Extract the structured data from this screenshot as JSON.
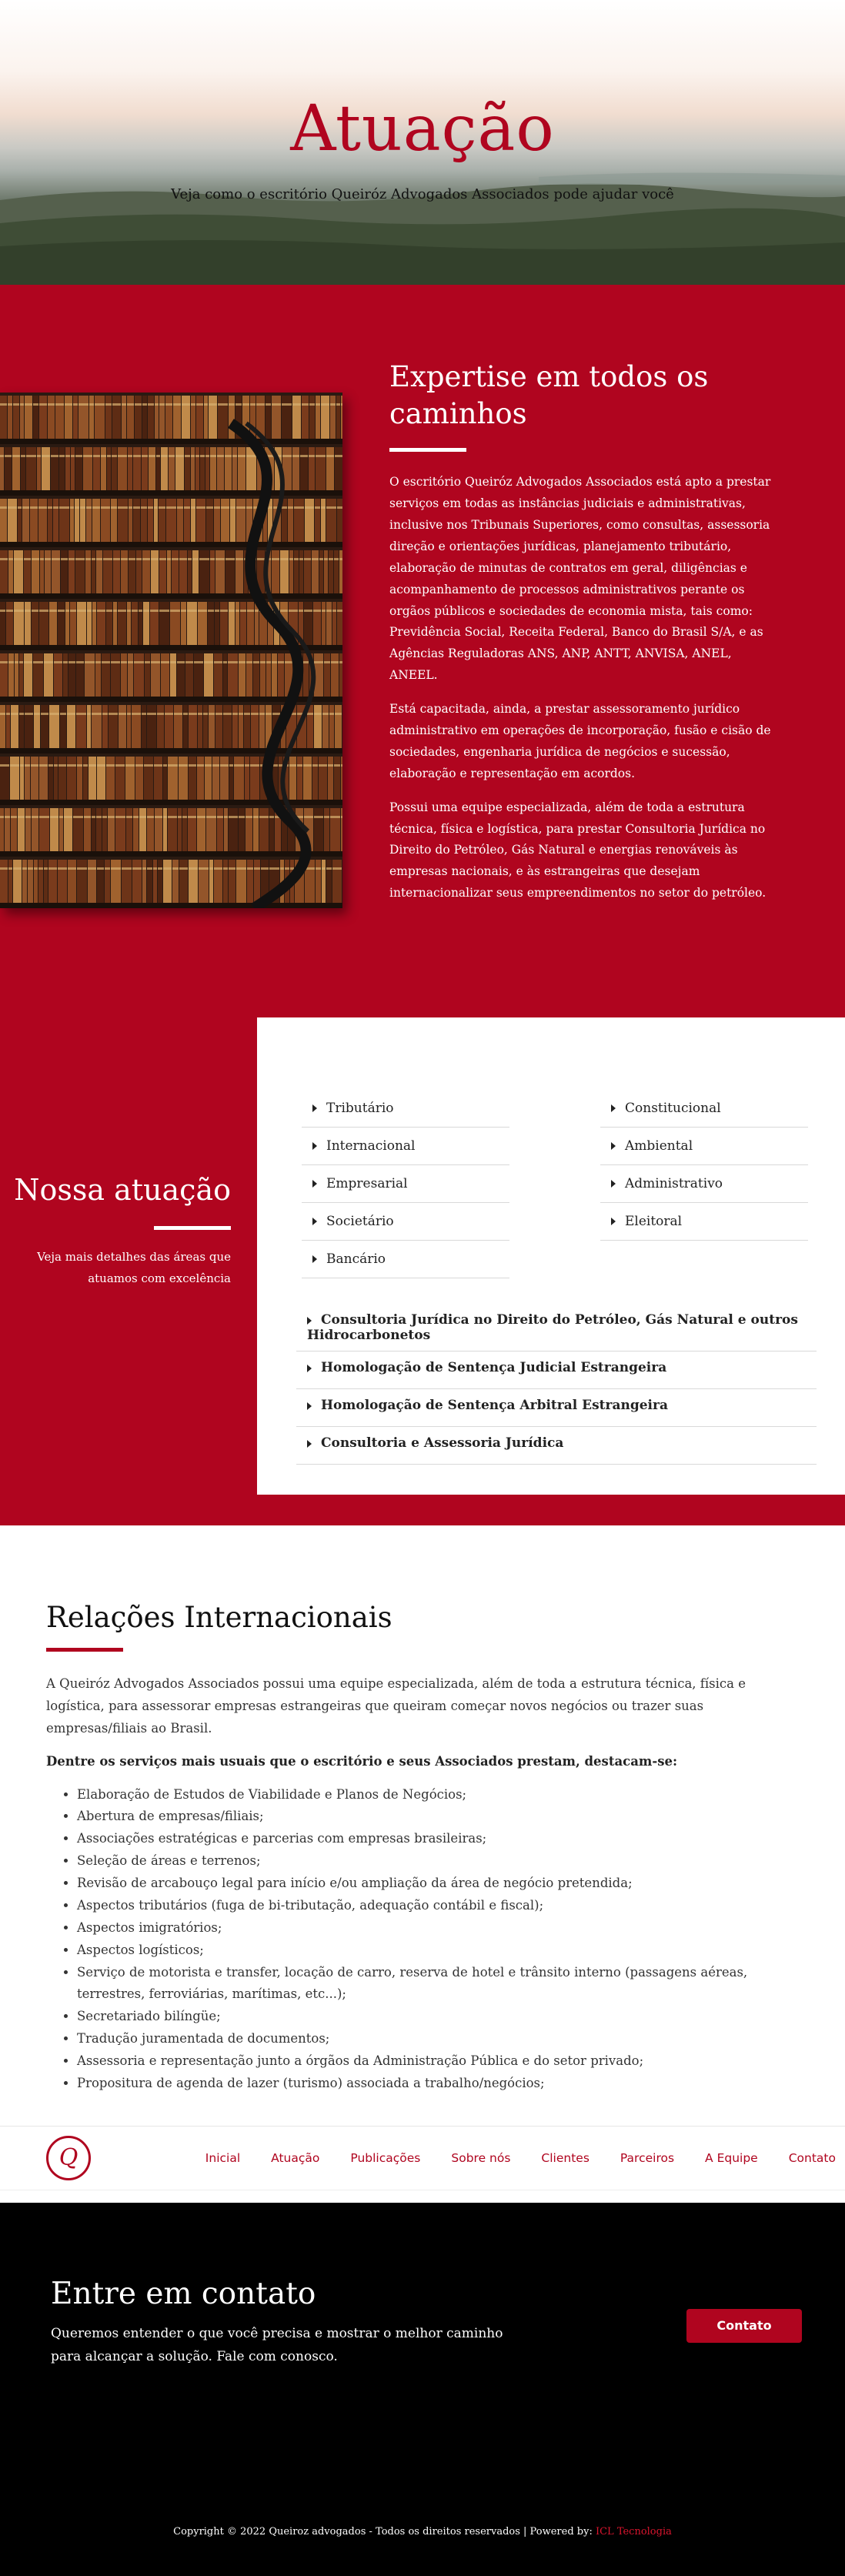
{
  "hero": {
    "title": "Atuação",
    "subtitle": "Veja como o escritório Queiróz Advogados Associados pode ajudar você"
  },
  "expertise": {
    "heading": "Expertise em todos os caminhos",
    "paragraphs": [
      "O escritório Queiróz Advogados Associados está apto a prestar serviços em todas as instâncias judiciais e administrativas, inclusive nos Tribunais Superiores, como consultas, assessoria direção e orientações jurídicas, planejamento tributário, elaboração de minutas de contratos em geral, diligências e acompanhamento de processos administrativos perante os orgãos públicos e sociedades de economia mista, tais como: Previdência Social, Receita Federal, Banco do Brasil S/A, e as Agências Reguladoras ANS, ANP, ANTT, ANVISA, ANEL, ANEEL.",
      "Está capacitada, ainda, a prestar assessoramento jurídico administrativo em operações de incorporação, fusão e cisão de sociedades, engenharia jurídica de negócios e sucessão, elaboração e representação em acordos.",
      "Possui uma equipe especializada, além de toda a estrutura técnica, física e logística, para prestar Consultoria Jurídica no Direito do Petróleo, Gás Natural e energias renováveis às empresas nacionais, e às estrangeiras que desejam internacionalizar seus empreendimentos no setor do petróleo."
    ]
  },
  "atuacao": {
    "heading": "Nossa atuação",
    "description": "Veja mais detalhes das áreas que atuamos com excelência",
    "col1": [
      "Tributário",
      "Internacional",
      "Empresarial",
      "Societário",
      "Bancário"
    ],
    "col2": [
      "Constitucional",
      "Ambiental",
      "Administrativo",
      "Eleitoral"
    ],
    "long": [
      "Consultoria Jurídica no Direito do Petróleo, Gás Natural e outros Hidrocarbonetos",
      "Homologação de Sentença Judicial Estrangeira",
      "Homologação de Sentença Arbitral Estrangeira",
      "Consultoria e Assessoria Jurídica"
    ]
  },
  "relacoes": {
    "heading": "Relações Internacionais",
    "intro": "A Queiróz Advogados Associados possui uma equipe especializada, além de toda a estrutura técnica, física e logística, para assessorar empresas estrangeiras que queiram começar novos negócios ou trazer suas empresas/filiais ao Brasil.",
    "lead": "Dentre os serviços mais usuais que o escritório e seus Associados prestam, destacam-se:",
    "items": [
      "Elaboração de Estudos de Viabilidade e Planos de Negócios;",
      "Abertura de empresas/filiais;",
      "Associações estratégicas e parcerias com empresas brasileiras;",
      "Seleção de áreas e terrenos;",
      "Revisão de arcabouço legal para início e/ou ampliação da área de negócio pretendida;",
      "Aspectos tributários (fuga de bi-tributação, adequação contábil e fiscal);",
      "Aspectos imigratórios;",
      "Aspectos logísticos;",
      "Serviço de motorista e transfer, locação de carro, reserva de hotel e trânsito interno (passagens aéreas, terrestres, ferroviárias, marítimas, etc...);",
      "Secretariado bilíngüe;",
      "Tradução juramentada de documentos;",
      "Assessoria e representação junto a órgãos da Administração Pública e do setor privado;",
      "Propositura de agenda de lazer (turismo) associada a trabalho/negócios;"
    ]
  },
  "nav": {
    "logo_letter": "Q",
    "links": [
      "Inicial",
      "Atuação",
      "Publicações",
      "Sobre nós",
      "Clientes",
      "Parceiros",
      "A Equipe",
      "Contato"
    ]
  },
  "contato": {
    "heading": "Entre em contato",
    "text": "Queremos entender o que você precisa e mostrar o melhor caminho para alcançar a solução. Fale com conosco.",
    "button": "Contato",
    "copyright": "Copyright © 2022 Queiroz advogados - Todos os direitos reservados | Powered by: ",
    "powered": "ICL Tecnologia"
  },
  "colors": {
    "brand_red": "#b0051f",
    "black": "#000000",
    "white": "#ffffff"
  }
}
